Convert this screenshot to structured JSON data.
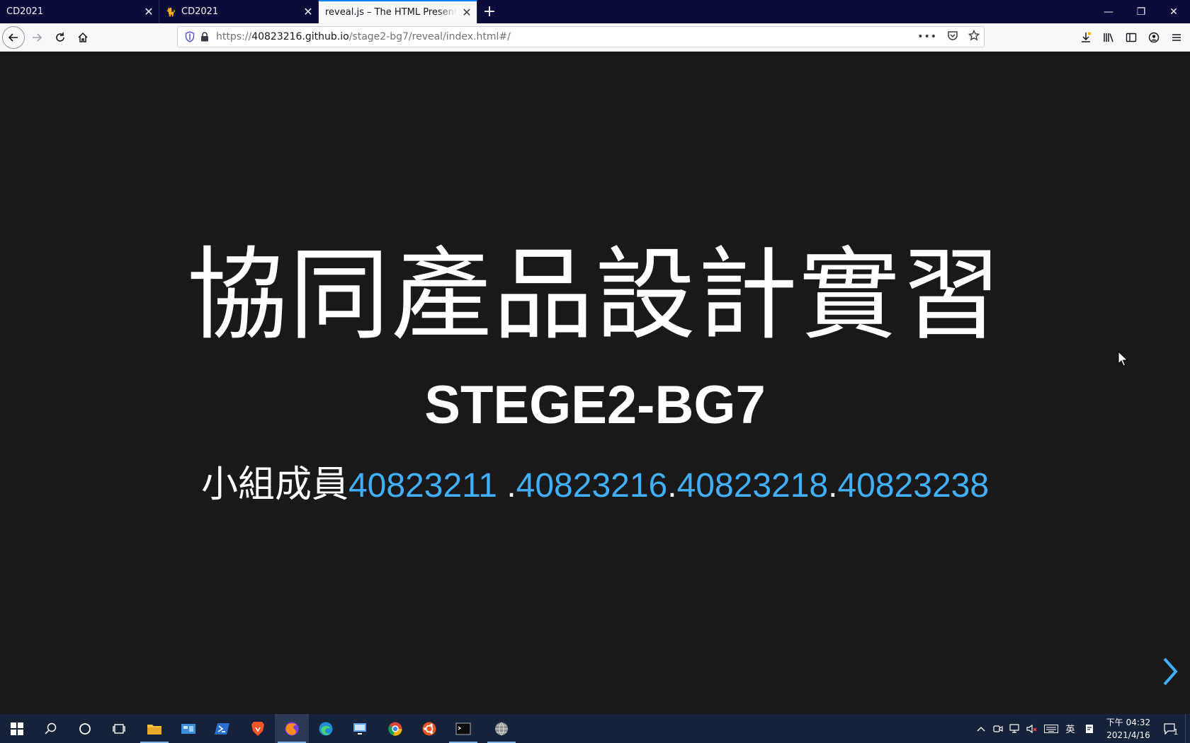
{
  "browser": {
    "tabs": [
      {
        "label": "CD2021",
        "active": false
      },
      {
        "label": "CD2021",
        "active": false
      },
      {
        "label": "reveal.js – The HTML Presentation Framework",
        "active": true
      }
    ],
    "url": {
      "prefix": "https://",
      "host": "40823216.github.io",
      "path": "/stage2-bg7/reveal/index.html#/"
    }
  },
  "slide": {
    "title": "協同產品設計實習",
    "subtitle": "STEGE2-BG7",
    "members_label": "小組成員",
    "members": [
      "40823211 ",
      ".",
      "40823216",
      ".",
      "40823218",
      ".",
      "40823238"
    ],
    "link_color": "#42affa",
    "background": "#191919"
  },
  "taskbar": {
    "time": "下午 04:32",
    "date": "2021/4/16",
    "ime": "英",
    "notification_count": "1"
  }
}
